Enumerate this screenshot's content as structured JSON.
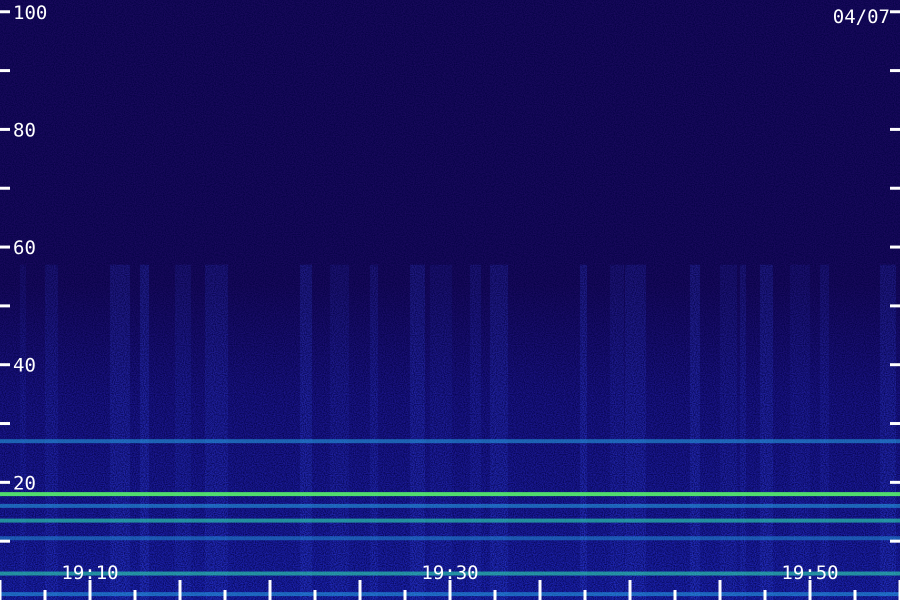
{
  "date_label": "04/07",
  "chart_data": {
    "type": "heatmap",
    "title": "",
    "xlabel": "",
    "ylabel": "",
    "x_range": [
      "19:05",
      "19:55"
    ],
    "x_tick_labels": [
      "19:10",
      "19:30",
      "19:50"
    ],
    "y_range": [
      0,
      102
    ],
    "y_tick_labels": [
      "20",
      "40",
      "60",
      "80",
      "100"
    ],
    "grid": false,
    "colormap": [
      "#000000",
      "#1a0a5e",
      "#2020c0",
      "#2f5cff",
      "#22c7e0",
      "#3fff7a"
    ],
    "bands": [
      {
        "y": 18.0,
        "intensity": 0.85
      },
      {
        "y": 16.0,
        "intensity": 0.55
      },
      {
        "y": 13.5,
        "intensity": 0.6
      },
      {
        "y": 10.5,
        "intensity": 0.45
      },
      {
        "y": 4.5,
        "intensity": 0.6
      },
      {
        "y": 1.0,
        "intensity": 0.55
      },
      {
        "y": 27.0,
        "intensity": 0.55
      }
    ]
  },
  "colors": {
    "axis": "#ffffff",
    "background": "#1a0a5e"
  }
}
